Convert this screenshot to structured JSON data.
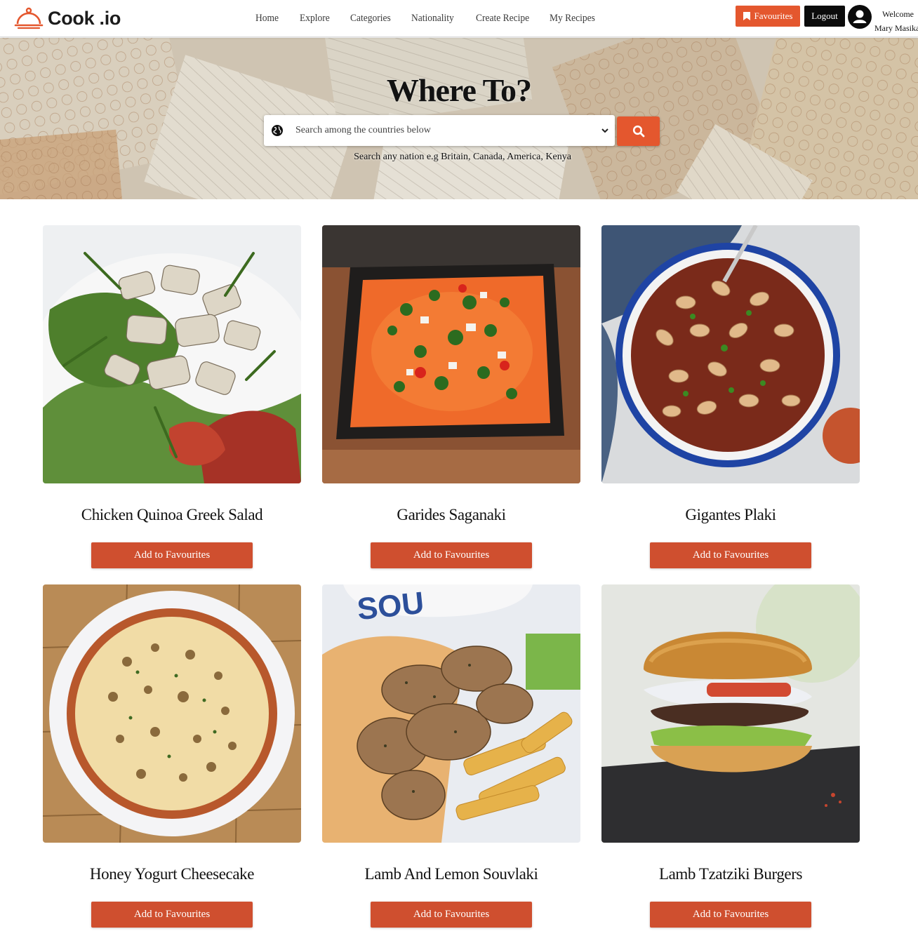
{
  "header": {
    "logo_text": "Cook .io",
    "nav": [
      "Home",
      "Explore",
      "Categories",
      "Nationality",
      "Create Recipe",
      "My Recipes"
    ],
    "favourites_label": "Favourites",
    "logout_label": "Logout",
    "welcome_label": "Welcome",
    "user_name": "Mary Masika"
  },
  "hero": {
    "title": "Where To?",
    "search_placeholder": "Search among the countries below",
    "hint": "Search any nation e.g Britain, Canada, America, Kenya"
  },
  "recipes": [
    {
      "title": "Chicken Quinoa Greek Salad",
      "button": "Add to Favourites"
    },
    {
      "title": "Garides Saganaki",
      "button": "Add to Favourites"
    },
    {
      "title": "Gigantes Plaki",
      "button": "Add to Favourites"
    },
    {
      "title": "Honey Yogurt Cheesecake",
      "button": "Add to Favourites"
    },
    {
      "title": "Lamb And Lemon Souvlaki",
      "button": "Add to Favourites"
    },
    {
      "title": "Lamb Tzatziki Burgers",
      "button": "Add to Favourites"
    }
  ],
  "colors": {
    "accent": "#e4572e",
    "card_button": "#cf4f2f",
    "logout": "#0b0b0b"
  },
  "icons": {
    "logo": "cloche-icon",
    "favourites": "bookmark-icon",
    "avatar": "user-avatar-icon",
    "search_prefix": "globe-icon",
    "dropdown": "chevron-down-icon",
    "search_button": "search-icon"
  }
}
